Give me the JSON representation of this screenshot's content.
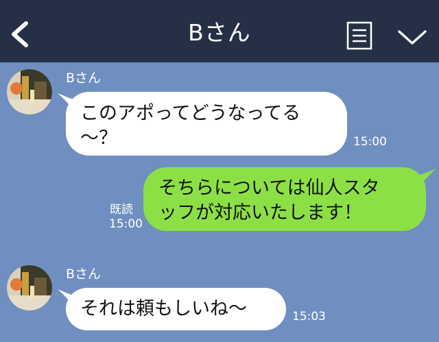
{
  "header": {
    "title": "Bさん"
  },
  "messages": [
    {
      "sender": "Bさん",
      "lines": [
        "このアポってどうなってる",
        "〜？"
      ],
      "time": "15:00"
    },
    {
      "lines": [
        "そちらについては仙人スタ",
        "ッフが対応いたします！"
      ],
      "read_label": "既読",
      "time": "15:00"
    },
    {
      "sender": "Bさん",
      "lines": [
        "それは頼もしいね〜"
      ],
      "time": "15:03"
    }
  ],
  "colors": {
    "header_bg": "#253046",
    "chat_bg": "#6f8fc0",
    "incoming_bubble": "#ffffff",
    "outgoing_bubble": "#8ce045"
  },
  "icons": {
    "back": "chevron-left-icon",
    "memo": "note-icon",
    "menu": "chevron-down-icon"
  }
}
